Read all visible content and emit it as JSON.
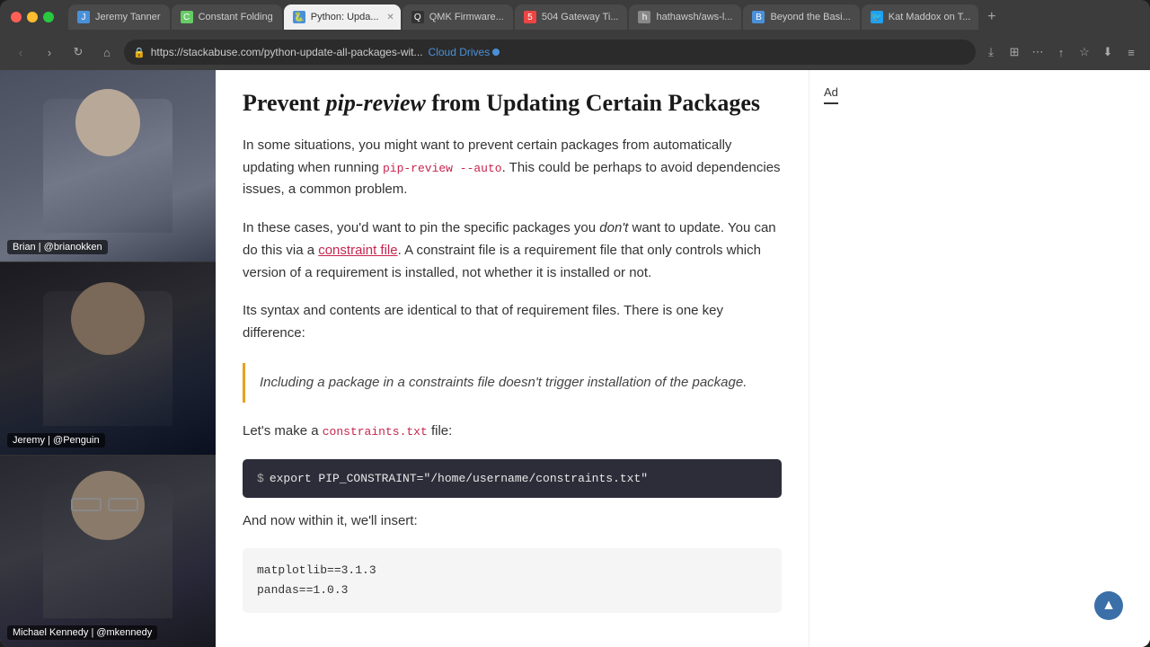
{
  "browser": {
    "traffic_lights": [
      "close",
      "minimize",
      "maximize"
    ],
    "tabs": [
      {
        "id": "jeremy",
        "label": "Jeremy Tanner",
        "favicon": "J",
        "fav_class": "fav-jeremy",
        "active": false
      },
      {
        "id": "constant",
        "label": "Constant Folding",
        "favicon": "C",
        "fav_class": "fav-constant",
        "active": false
      },
      {
        "id": "python",
        "label": "Python: Upda...",
        "favicon": "P",
        "fav_class": "fav-python",
        "active": true
      },
      {
        "id": "qmk",
        "label": "QMK Firmware...",
        "favicon": "Q",
        "fav_class": "fav-qmk",
        "active": false
      },
      {
        "id": "gateway",
        "label": "504 Gateway Ti...",
        "favicon": "5",
        "fav_class": "fav-gateway",
        "active": false
      },
      {
        "id": "hathawsh",
        "label": "hathawsh/aws-l...",
        "favicon": "h",
        "fav_class": "fav-hathawsh",
        "active": false
      },
      {
        "id": "beyond",
        "label": "Beyond the Basi...",
        "favicon": "B",
        "fav_class": "fav-beyond",
        "active": false
      },
      {
        "id": "kat",
        "label": "Kat Maddox on T...",
        "favicon": "K",
        "fav_class": "fav-kat",
        "active": false
      }
    ],
    "url_prefix": "https://stackabuse.com/python-update-all-packages-wit...",
    "cloud_drives_label": "Cloud Drives"
  },
  "videos": [
    {
      "id": "brian",
      "label": "Brian | @brianokken",
      "bg_class": "face-shape-1"
    },
    {
      "id": "jeremy",
      "label": "Jeremy | @Penguin",
      "bg_class": "face-shape-2"
    },
    {
      "id": "michael",
      "label": "Michael Kennedy | @mkennedy",
      "bg_class": "face-shape-3"
    }
  ],
  "article": {
    "title_part1": "Prevent ",
    "title_italic": "pip-review",
    "title_part2": " from Updating Certain Packages",
    "para1_before": "In some situations, you might want to prevent certain packages from automatically updating when running ",
    "para1_code": "pip-review --auto",
    "para1_after": ". This could be perhaps to avoid dependencies issues, a common problem.",
    "para2_before": "In these cases, you'd want to pin the specific packages you ",
    "para2_italic": "don't",
    "para2_middle": " want to update. You can do this via a ",
    "para2_link": "constraint file",
    "para2_after": ". A constraint file is a requirement file that only controls which version of a requirement is installed, not whether it is installed or not.",
    "para3": "Its syntax and contents are identical to that of requirement files. There is one key difference:",
    "blockquote": "Including a package in a constraints file doesn't trigger installation of the package.",
    "para4_before": "Let's make a ",
    "para4_code": "constraints.txt",
    "para4_after": " file:",
    "code_block1_prompt": "$",
    "code_block1_cmd": "export PIP_CONSTRAINT=\"/home/username/constraints.txt\"",
    "para5": "And now within it, we'll insert:",
    "code_block2_line1": "matplotlib==3.1.3",
    "code_block2_line2": "pandas==1.0.3"
  },
  "ad": {
    "label": "Ad"
  },
  "scroll_top": "▲"
}
